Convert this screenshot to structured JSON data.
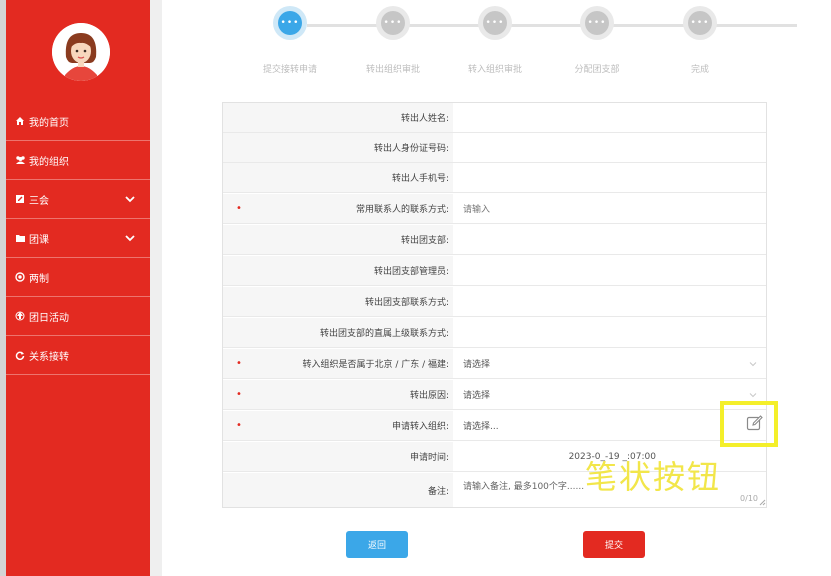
{
  "sidebar": {
    "items": [
      {
        "label": "我的首页",
        "icon": "home-icon"
      },
      {
        "label": "我的组织",
        "icon": "group-icon"
      },
      {
        "label": "三会",
        "icon": "edit-square-icon",
        "expandable": true
      },
      {
        "label": "团课",
        "icon": "folder-icon",
        "expandable": true
      },
      {
        "label": "两制",
        "icon": "target-icon"
      },
      {
        "label": "团日活动",
        "icon": "recycle-icon"
      },
      {
        "label": "关系接转",
        "icon": "refresh-icon"
      }
    ]
  },
  "steps": [
    {
      "label": "提交接转申请",
      "active": true
    },
    {
      "label": "转出组织审批",
      "active": false
    },
    {
      "label": "转入组织审批",
      "active": false
    },
    {
      "label": "分配团支部",
      "active": false
    },
    {
      "label": "完成",
      "active": false
    }
  ],
  "step_dots_text": "•••",
  "form": {
    "rows": [
      {
        "label": "转出人姓名:",
        "value": "",
        "required": false
      },
      {
        "label": "转出人身份证号码:",
        "value": "",
        "required": false
      },
      {
        "label": "转出人手机号:",
        "value": "",
        "required": false
      },
      {
        "label": "常用联系人的联系方式:",
        "value": "请输入",
        "required": true
      },
      {
        "label": "转出团支部:",
        "value": "",
        "required": false
      },
      {
        "label": "转出团支部管理员:",
        "value": "",
        "required": false
      },
      {
        "label": "转出团支部联系方式:",
        "value": "",
        "required": false
      },
      {
        "label": "转出团支部的直属上级联系方式:",
        "value": "",
        "required": false
      },
      {
        "label": "转入组织是否属于北京 / 广东 / 福建:",
        "value": "请选择",
        "required": true,
        "dropdown": true
      },
      {
        "label": "转出原因:",
        "value": "请选择",
        "required": true,
        "dropdown": true
      },
      {
        "label": "申请转入组织:",
        "value": "请选择...",
        "required": true,
        "pen": true
      },
      {
        "label": "申请时间:",
        "value": "2023-0_-19 _:07:00",
        "required": false
      },
      {
        "label": "备注:",
        "value": "请输入备注, 最多100个字......",
        "required": false,
        "counter": "0/10"
      }
    ],
    "required_mark": "•"
  },
  "overlay_caption": "笔状按钮",
  "buttons": {
    "back": "返回",
    "submit": "提交"
  },
  "colors": {
    "sidebar": "#e32a21",
    "primary": "#3ba7e8",
    "highlight": "#f4ef2a"
  }
}
